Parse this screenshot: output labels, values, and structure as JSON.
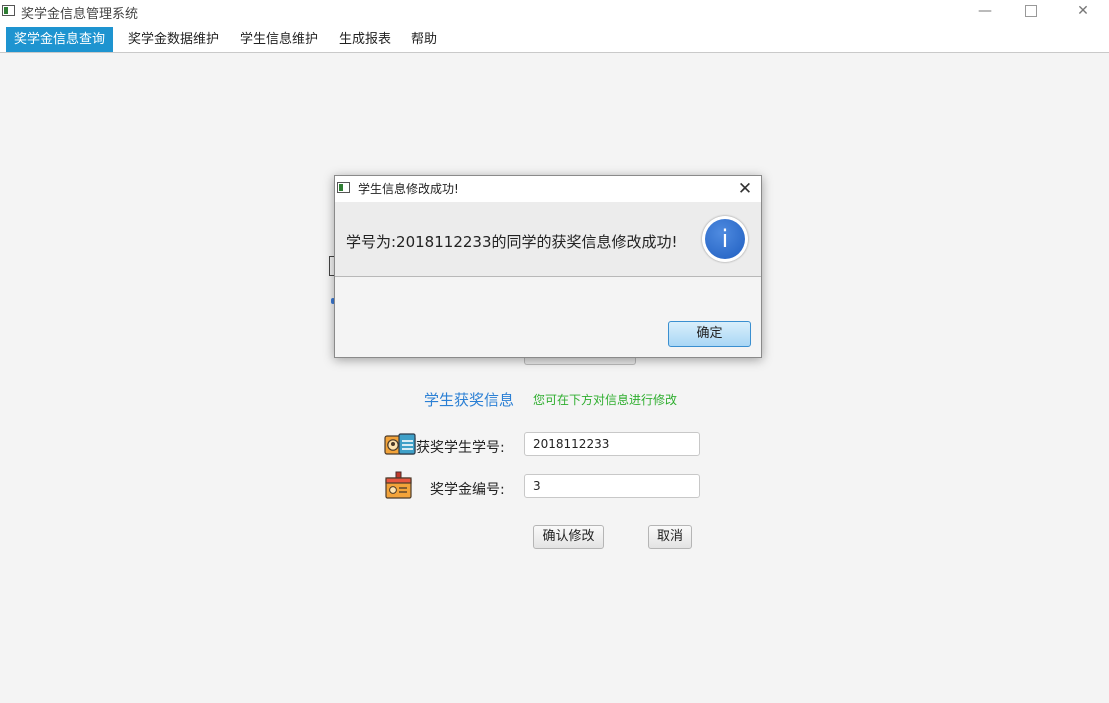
{
  "window": {
    "title": "奖学金信息管理系统",
    "minimize_glyph": "—",
    "close_glyph": "✕"
  },
  "menu": {
    "items": [
      {
        "label": "奖学金信息查询",
        "active": true
      },
      {
        "label": "奖学金数据维护",
        "active": false
      },
      {
        "label": "学生信息维护",
        "active": false
      },
      {
        "label": "生成报表",
        "active": false
      },
      {
        "label": "帮助",
        "active": false
      }
    ]
  },
  "form": {
    "section_title": "学生获奖信息",
    "hint": "您可在下方对信息进行修改",
    "student_id_label": "获奖学生学号:",
    "student_id_value": "2018112233",
    "scholarship_id_label": "奖学金编号:",
    "scholarship_id_value": "3",
    "confirm_label": "确认修改",
    "cancel_label": "取消"
  },
  "dialog": {
    "title": "学生信息修改成功!",
    "message": "学号为:2018112233的同学的获奖信息修改成功!",
    "ok_label": "确定",
    "close_glyph": "✕",
    "info_glyph": "i"
  },
  "icons": {
    "app": "app-window-icon",
    "info": "info-icon",
    "student_card": "student-id-card-icon",
    "badge": "badge-icon"
  },
  "colors": {
    "menu_active": "#1e94d0",
    "section_title": "#2a7fd4",
    "hint": "#2fae2f",
    "info_icon": "#2a6ed0"
  }
}
